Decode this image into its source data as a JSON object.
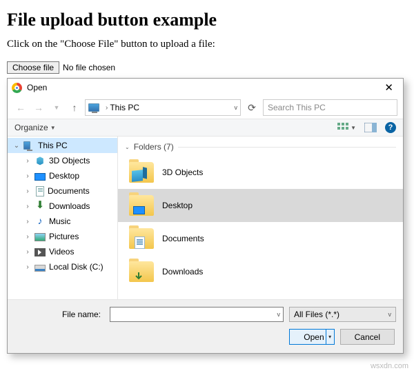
{
  "page": {
    "heading": "File upload button example",
    "intro": "Click on the \"Choose File\" button to upload a file:",
    "choose_label": "Choose file",
    "no_file_label": "No file chosen"
  },
  "dialog": {
    "title": "Open",
    "breadcrumb": {
      "location": "This PC"
    },
    "search_placeholder": "Search This PC",
    "toolbar": {
      "organize_label": "Organize"
    },
    "tree": {
      "root": {
        "label": "This PC"
      },
      "items": [
        {
          "label": "3D Objects",
          "icon": "3d"
        },
        {
          "label": "Desktop",
          "icon": "desktop"
        },
        {
          "label": "Documents",
          "icon": "doc"
        },
        {
          "label": "Downloads",
          "icon": "down"
        },
        {
          "label": "Music",
          "icon": "music"
        },
        {
          "label": "Pictures",
          "icon": "pic"
        },
        {
          "label": "Videos",
          "icon": "vid"
        },
        {
          "label": "Local Disk (C:)",
          "icon": "disk"
        }
      ]
    },
    "folders_header": "Folders (7)",
    "items": [
      {
        "label": "3D Objects",
        "selected": false,
        "inner": "cube"
      },
      {
        "label": "Desktop",
        "selected": true,
        "inner": "screen"
      },
      {
        "label": "Documents",
        "selected": false,
        "inner": "doc"
      },
      {
        "label": "Downloads",
        "selected": false,
        "inner": "arrow"
      }
    ],
    "footer": {
      "filename_label": "File name:",
      "filename_value": "",
      "filter_label": "All Files (*.*)",
      "open_label": "Open",
      "cancel_label": "Cancel"
    }
  },
  "watermark": "wsxdn.com"
}
